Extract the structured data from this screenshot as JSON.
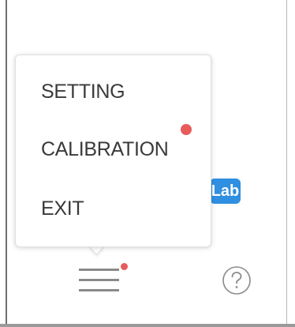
{
  "menu": {
    "items": [
      {
        "label": "SETTING"
      },
      {
        "label": "CALIBRATION",
        "has_notification": true
      },
      {
        "label": "EXIT"
      }
    ]
  },
  "badge": {
    "label": "Lab",
    "color": "#2f8fe0"
  },
  "toolbar": {
    "menu_icon": "hamburger-menu-icon",
    "menu_has_notification": true,
    "help_icon": "question-circle-icon"
  },
  "colors": {
    "notification": "#e85b5b",
    "menu_text": "#3a3a3a",
    "icon": "#8a8a8a"
  }
}
